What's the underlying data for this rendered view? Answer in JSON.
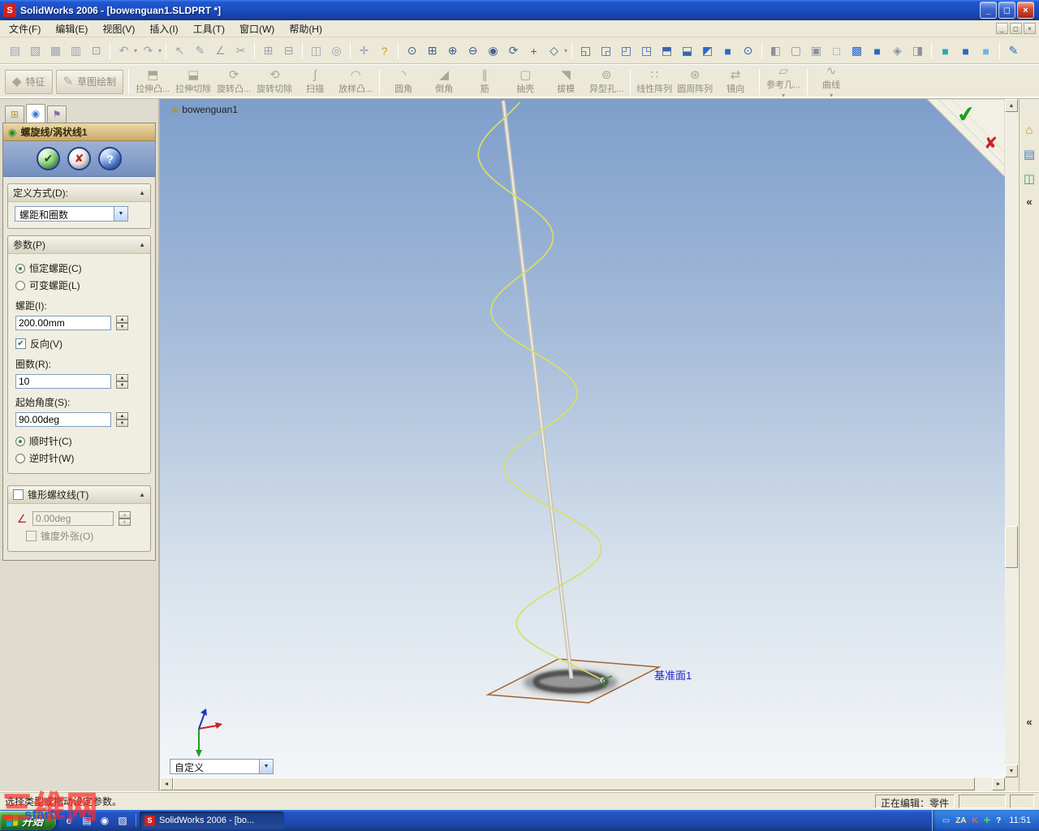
{
  "window": {
    "app_initial": "S",
    "title": "SolidWorks 2006 - [bowenguan1.SLDPRT *]"
  },
  "icons": {
    "minimize": "_",
    "restore": "◻",
    "close": "×",
    "dropdown": "▼",
    "collapse": "▲",
    "spin_up": "▲",
    "spin_down": "▼",
    "scroll_up": "▲",
    "scroll_down": "▼",
    "scroll_left": "◄",
    "scroll_right": "►",
    "chevron_collapse": "«",
    "check": "✔",
    "cross": "✘",
    "help": "?",
    "home": "⌂",
    "library": "▤",
    "explorer": "◫",
    "part": "◈",
    "caret": "▾",
    "angle": "∠"
  },
  "menu": {
    "items": [
      "文件(F)",
      "编辑(E)",
      "视图(V)",
      "插入(I)",
      "工具(T)",
      "窗口(W)",
      "帮助(H)"
    ]
  },
  "toolbar_std": [
    {
      "name": "new-document-icon",
      "glyph": "▤"
    },
    {
      "name": "open-icon",
      "glyph": "▧"
    },
    {
      "name": "save-icon",
      "glyph": "▦"
    },
    {
      "name": "print-icon",
      "glyph": "▥"
    },
    {
      "name": "print-preview-icon",
      "glyph": "⊡"
    },
    {
      "sep": true
    },
    {
      "name": "undo-icon",
      "glyph": "↶",
      "caret": true
    },
    {
      "name": "redo-icon",
      "glyph": "↷",
      "caret": true
    },
    {
      "sep": true
    },
    {
      "name": "select-icon",
      "glyph": "↖"
    },
    {
      "name": "sketch-icon",
      "glyph": "✎"
    },
    {
      "name": "dimension-icon",
      "glyph": "∠"
    },
    {
      "name": "trim-icon",
      "glyph": "✂"
    },
    {
      "sep": true
    },
    {
      "name": "grid-icon",
      "glyph": "⊞"
    },
    {
      "name": "options-icon",
      "glyph": "⊟"
    },
    {
      "sep": true
    },
    {
      "name": "convert-entities-icon",
      "glyph": "◫"
    },
    {
      "name": "offset-entities-icon",
      "glyph": "◎"
    },
    {
      "sep": true
    },
    {
      "name": "measure-icon",
      "glyph": "✛"
    },
    {
      "name": "help-icon",
      "glyph": "?",
      "color": "#caa21d"
    },
    {
      "sep": true
    },
    {
      "name": "zoom-fit-icon",
      "glyph": "⊙",
      "color": "#42608c"
    },
    {
      "name": "zoom-area-icon",
      "glyph": "⊞",
      "color": "#42608c"
    },
    {
      "name": "zoom-in-icon",
      "glyph": "⊕",
      "color": "#42608c"
    },
    {
      "name": "zoom-out-icon",
      "glyph": "⊖",
      "color": "#42608c"
    },
    {
      "name": "zoom-selection-icon",
      "glyph": "◉",
      "color": "#42608c"
    },
    {
      "name": "rotate-view-icon",
      "glyph": "⟳",
      "color": "#42608c"
    },
    {
      "name": "pan-icon",
      "glyph": "+",
      "color": "#42608c"
    },
    {
      "name": "view-orientation-icon",
      "glyph": "◇",
      "color": "#42608c",
      "caret": true
    },
    {
      "sep": true
    },
    {
      "name": "view-front-icon",
      "glyph": "◱",
      "color": "#3764b0"
    },
    {
      "name": "view-back-icon",
      "glyph": "◲",
      "color": "#3764b0"
    },
    {
      "name": "view-left-icon",
      "glyph": "◰",
      "color": "#3764b0"
    },
    {
      "name": "view-right-icon",
      "glyph": "◳",
      "color": "#3764b0"
    },
    {
      "name": "view-top-icon",
      "glyph": "⬒",
      "color": "#3764b0"
    },
    {
      "name": "view-bottom-icon",
      "glyph": "⬓",
      "color": "#3764b0"
    },
    {
      "name": "view-isometric-icon",
      "glyph": "◩",
      "color": "#2f66c8"
    },
    {
      "name": "view-dimetric-icon",
      "glyph": "■",
      "color": "#2f66c8"
    },
    {
      "name": "normal-to-icon",
      "glyph": "⊙",
      "color": "#3764b0"
    },
    {
      "sep": true
    },
    {
      "name": "section-view-icon",
      "glyph": "◧",
      "color": "#8a92a0"
    },
    {
      "name": "wireframe-icon",
      "glyph": "▢",
      "color": "#8a92a0"
    },
    {
      "name": "hidden-lines-visible-icon",
      "glyph": "▣",
      "color": "#8a92a0"
    },
    {
      "name": "hidden-lines-removed-icon",
      "glyph": "□",
      "color": "#8a92a0"
    },
    {
      "name": "shaded-with-edges-icon",
      "glyph": "▩",
      "color": "#2f66c8"
    },
    {
      "name": "shaded-icon",
      "glyph": "■",
      "color": "#2f66c8"
    },
    {
      "name": "perspective-icon",
      "glyph": "◈",
      "color": "#8a92a0"
    },
    {
      "name": "shadows-icon",
      "glyph": "◨",
      "color": "#8a92a0"
    },
    {
      "sep": true
    },
    {
      "name": "edit-color-icon",
      "glyph": "■",
      "color": "#2aa7b8"
    },
    {
      "name": "texture-icon",
      "glyph": "■",
      "color": "#2f66c8"
    },
    {
      "name": "scene-icon",
      "glyph": "■",
      "color": "#6fb3e8"
    },
    {
      "sep": true
    },
    {
      "name": "annotation-pen-icon",
      "glyph": "✎",
      "color": "#2f66c8"
    }
  ],
  "toolbar_features": [
    {
      "name": "features-tab-button",
      "label": "特征",
      "glyph": "◆",
      "ctrl": true
    },
    {
      "name": "sketch-tab-button",
      "label": "草图绘制",
      "glyph": "✎",
      "ctrl": true
    },
    {
      "sep": true
    },
    {
      "name": "extrude-boss-button",
      "label": "拉伸凸...",
      "glyph": "⬒"
    },
    {
      "name": "extrude-cut-button",
      "label": "拉伸切除",
      "glyph": "⬓"
    },
    {
      "name": "revolve-boss-button",
      "label": "旋转凸...",
      "glyph": "⟳"
    },
    {
      "name": "revolve-cut-button",
      "label": "旋转切除",
      "glyph": "⟲"
    },
    {
      "name": "sweep-button",
      "label": "扫描",
      "glyph": "∫"
    },
    {
      "name": "loft-button",
      "label": "放样凸...",
      "glyph": "◠"
    },
    {
      "sep": true
    },
    {
      "name": "fillet-button",
      "label": "圆角",
      "glyph": "◝"
    },
    {
      "name": "chamfer-button",
      "label": "倒角",
      "glyph": "◢"
    },
    {
      "name": "rib-button",
      "label": "筋",
      "glyph": "∥"
    },
    {
      "name": "shell-button",
      "label": "抽壳",
      "glyph": "▢"
    },
    {
      "name": "draft-button",
      "label": "拔模",
      "glyph": "◥"
    },
    {
      "name": "hole-wizard-button",
      "label": "异型孔...",
      "glyph": "⊚"
    },
    {
      "sep": true
    },
    {
      "name": "linear-pattern-button",
      "label": "线性阵列",
      "glyph": "∷"
    },
    {
      "name": "circular-pattern-button",
      "label": "圆周阵列",
      "glyph": "⊛"
    },
    {
      "name": "mirror-button",
      "label": "镜向",
      "glyph": "⇄"
    },
    {
      "sep": true
    },
    {
      "name": "reference-geometry-button",
      "label": "参考几...",
      "glyph": "▱",
      "caret": true
    },
    {
      "sep": true
    },
    {
      "name": "curves-button",
      "label": "曲线",
      "glyph": "∿",
      "caret": true
    }
  ],
  "panel": {
    "tabs": [
      {
        "name": "featuremanager-tab",
        "glyph": "⊞",
        "color": "#c09a30"
      },
      {
        "name": "propertymanager-tab",
        "glyph": "◉",
        "color": "#3a7ad0",
        "active": true
      },
      {
        "name": "configurationmanager-tab",
        "glyph": "⚑",
        "color": "#8a68b0"
      }
    ],
    "title": "螺旋线/涡状线1",
    "def_group": {
      "title": "定义方式(D):",
      "value": "螺距和圈数"
    },
    "param_group": {
      "title": "参数(P)",
      "constant": "恒定螺距(C)",
      "variable": "可变螺距(L)",
      "pitch_label": "螺距(I):",
      "pitch": "200.00mm",
      "reverse": "反向(V)",
      "rev_label": "圈数(R):",
      "rev": "10",
      "start_label": "起始角度(S):",
      "start": "90.00deg",
      "cw": "顺时针(C)",
      "ccw": "逆时针(W)"
    },
    "taper_group": {
      "title": "锥形螺纹线(T)",
      "angle": "0.00deg",
      "outward": "锥度外张(O)"
    }
  },
  "viewport": {
    "part": "bowenguan1",
    "plane": "基准面1",
    "combo": "自定义"
  },
  "statusbar": {
    "message": "选择类型或拖动设定参数。",
    "editing": "正在编辑：零件"
  },
  "taskbar": {
    "start": "开始",
    "task": "SolidWorks 2006 - [bo...",
    "task_icon_initial": "S",
    "time": "11:51",
    "quick": [
      {
        "name": "internet-explorer-icon",
        "glyph": "e"
      },
      {
        "name": "show-desktop-icon",
        "glyph": "▤"
      },
      {
        "name": "media-player-icon",
        "glyph": "◉"
      },
      {
        "name": "folders-icon",
        "glyph": "▨"
      }
    ],
    "tray": [
      {
        "name": "display-icon",
        "glyph": "▭",
        "color": "#cfe4ff"
      },
      {
        "name": "ime-icon",
        "glyph": "ZA",
        "color": "#ffe9a8"
      },
      {
        "name": "kingsoft-icon",
        "glyph": "K",
        "color": "#ff5a4a"
      },
      {
        "name": "antivirus-icon",
        "glyph": "✚",
        "color": "#5ad05a"
      },
      {
        "name": "help-tray-icon",
        "glyph": "?",
        "color": "#ffffff"
      }
    ]
  },
  "watermark": {
    "cn": "三维网",
    "en": "start.cn"
  }
}
